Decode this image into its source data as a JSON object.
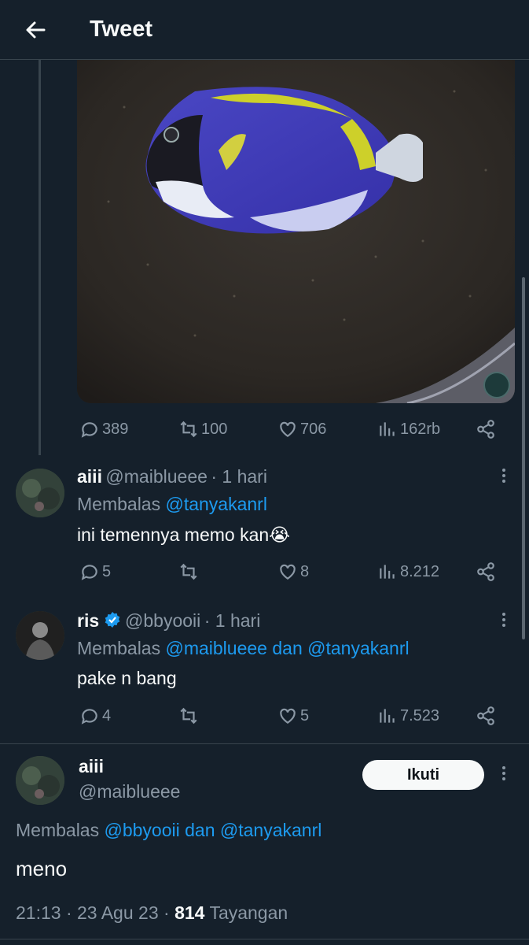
{
  "header": {
    "title": "Tweet"
  },
  "main_tweet": {
    "stats": {
      "replies": "389",
      "retweets": "100",
      "likes": "706",
      "views": "162rb"
    }
  },
  "replies": [
    {
      "name": "aiii",
      "handle": "@maiblueee",
      "time": "· 1 hari",
      "replying_prefix": "Membalas ",
      "replying_to": [
        "@tanyakanrl"
      ],
      "replying_join": "",
      "text": "ini temennya memo kan😭",
      "stats": {
        "replies": "5",
        "retweets": "",
        "likes": "8",
        "views": "8.212"
      }
    },
    {
      "name": "ris",
      "handle": "@bbyooii",
      "time": "· 1 hari",
      "verified": true,
      "replying_prefix": "Membalas ",
      "replying_to": [
        "@maiblueee",
        "@tanyakanrl"
      ],
      "replying_join": " dan ",
      "text": "pake n bang",
      "stats": {
        "replies": "4",
        "retweets": "",
        "likes": "5",
        "views": "7.523"
      }
    }
  ],
  "focused_tweet": {
    "name": "aiii",
    "handle": "@maiblueee",
    "follow_label": "Ikuti",
    "replying_prefix": "Membalas ",
    "replying_to": [
      "@bbyooii",
      "@tanyakanrl"
    ],
    "replying_join": " dan ",
    "text": "meno",
    "time": "21:13",
    "date": "23 Agu 23",
    "dot": "·",
    "views_count": "814",
    "views_label": "Tayangan"
  },
  "colors": {
    "background": "#15202b",
    "accent": "#1d9bf0",
    "muted": "#8b98a5",
    "verified": "#1d9bf0"
  },
  "icons": [
    "back-arrow-icon",
    "reply-icon",
    "retweet-icon",
    "like-icon",
    "views-icon",
    "share-icon",
    "more-icon",
    "verified-badge-icon"
  ]
}
